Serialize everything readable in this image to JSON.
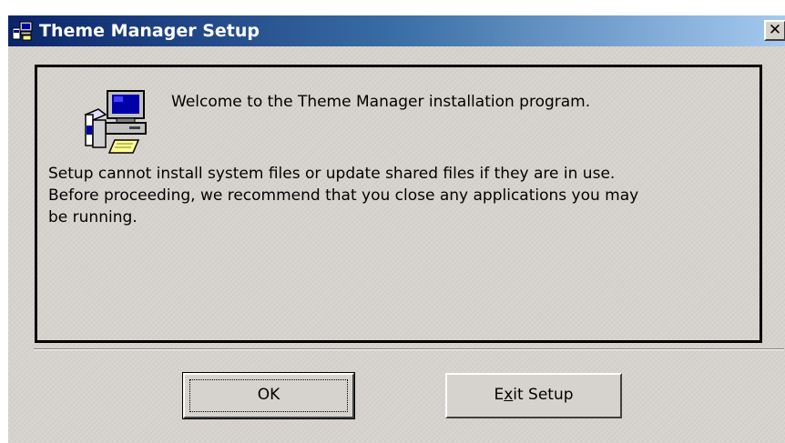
{
  "window": {
    "title": "Theme Manager Setup",
    "close_glyph": "✕",
    "title_icon": "setup-computer-icon"
  },
  "content": {
    "icon": "installer-computer-icon",
    "welcome": "Welcome to the Theme Manager installation program.",
    "body_lines": [
      "Setup cannot install system files or update shared files if they are in use.",
      "Before proceeding, we recommend that you close any applications you may",
      "be running."
    ]
  },
  "buttons": {
    "ok_label": "OK",
    "exit_pre": "E",
    "exit_mnemonic": "x",
    "exit_post": "it Setup"
  },
  "colors": {
    "titlebar_start": "#0a246a",
    "titlebar_end": "#a6caf0",
    "dialog_face": "#d6d3ce"
  }
}
